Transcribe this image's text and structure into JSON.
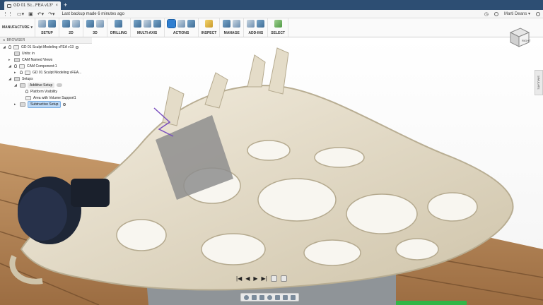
{
  "tabbar": {
    "tab_title": "GD 01 Sc...FEA v13*",
    "new_tab": "+"
  },
  "qat": {
    "backup_text": "Last backup made 6 minutes ago",
    "user_name": "Marti Deans",
    "dropdown": "▾"
  },
  "ribbon": {
    "workspace": "MANUFACTURE",
    "groups": {
      "setup": "SETUP",
      "two_d": "2D",
      "three_d": "3D",
      "drilling": "DRILLING",
      "multi_axis": "MULTI-AXIS",
      "actions": "ACTIONS",
      "inspect": "INSPECT",
      "manage": "MANAGE",
      "add_ins": "ADD-INS",
      "select": "SELECT"
    }
  },
  "browser": {
    "title": "BROWSER",
    "items": {
      "root": "GD 01 Sculpt Modeling vFEA v13",
      "units": "Units: in",
      "cam_views": "CAM Named Views",
      "cam_component": "CAM Component:1",
      "sub_model": "GD 01 Sculpt Modeling vFEA...",
      "setups": "Setups",
      "additive": "Additive Setup",
      "platform": "Platform Visibility",
      "area": "Area with Volume Support1",
      "subtractive": "Subtractive Setup"
    }
  },
  "viewcube": {
    "face": "RIGHT"
  },
  "side_panel": {
    "label": "SIMULATE"
  },
  "colors": {
    "title_bar": "#2d4e73",
    "model": "#e8e0cc",
    "wood": "#b88b5c",
    "knob": "#1e2636",
    "selection": "#2f7fd1"
  },
  "icons": [
    "app-grid-icon",
    "file-icon",
    "save-icon",
    "undo-icon",
    "redo-icon",
    "close-icon",
    "help-icon",
    "notification-icon",
    "timeline-play-icon"
  ]
}
